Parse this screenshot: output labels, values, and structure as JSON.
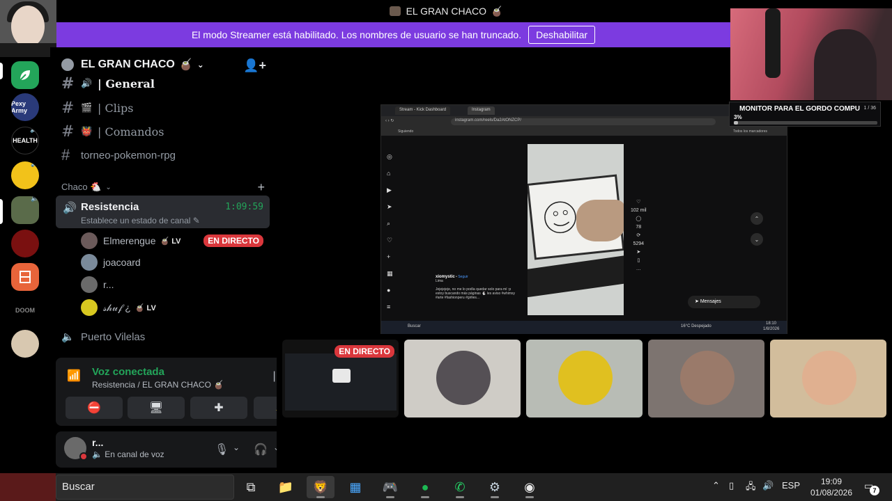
{
  "window": {
    "title": "EL GRAN CHACO",
    "title_emoji": "🧉"
  },
  "banner": {
    "text": "El modo Streamer está habilitado. Los nombres de usuario se han truncado.",
    "button": "Deshabilitar"
  },
  "servers": [
    {
      "label": "",
      "color": "#23a55a",
      "active": true
    },
    {
      "label": "Pexy Army",
      "color": "#2a3a7a"
    },
    {
      "label": "HEALTH",
      "color": "#000000",
      "speaker": true
    },
    {
      "label": "",
      "color": "#f2c21a",
      "speaker": true
    },
    {
      "label": "",
      "color": "#5a6b4a",
      "speaker": true,
      "active": true
    },
    {
      "label": "",
      "color": "#7a1010"
    },
    {
      "label": "",
      "color": "#e8643a"
    },
    {
      "label": "DOOM",
      "color": "#000000"
    },
    {
      "label": "",
      "color": "#d8c8b0"
    }
  ],
  "sidebar": {
    "server_name": "EL GRAN CHACO",
    "server_emoji": "🧉",
    "channels": [
      {
        "icon": "🔊",
        "name": "| General"
      },
      {
        "icon": "🎬",
        "name": "| Clips"
      },
      {
        "icon": "👹",
        "name": "| Comandos"
      },
      {
        "icon": "",
        "name": "torneo-pokemon-rpg"
      }
    ],
    "category": "Chaco 🐔",
    "voice_channel": {
      "name": "Resistencia",
      "time": "1:09:59",
      "status": "Establece un estado de canal"
    },
    "voice_users": [
      {
        "name": "Elmerengue",
        "badge": "🧉 LV",
        "live": "EN DIRECTO",
        "color": "#6b5a5a"
      },
      {
        "name": "joacoard",
        "badge": "",
        "live": "",
        "color": "#7a8a9a"
      },
      {
        "name": "r...",
        "badge": "",
        "live": "",
        "color": "#6a6a6a"
      },
      {
        "name": "𝓈𝒽𝓊𝒻 ¿",
        "badge": "🧉 LV",
        "live": "",
        "color": "#d8c820"
      }
    ],
    "voice2": "Puerto Vilelas"
  },
  "voice_panel": {
    "title": "Voz conectada",
    "subtitle": "Resistencia / EL GRAN CHACO 🧉",
    "buttons": [
      "camera-off",
      "screen-share",
      "activities",
      "soundboard"
    ]
  },
  "user_panel": {
    "name": "r...",
    "status": "En canal de voz"
  },
  "stream": {
    "tabs": [
      "Stream - Kick Dashboard",
      "Instagram"
    ],
    "url": "instagram.com/reels/Da2AtONZCP/",
    "bookmark": "Siguiendo",
    "all_bookmarks": "Todos los marcadores",
    "author": "xiomystic",
    "follow": "Seguir",
    "location": "Lima",
    "caption": "Jejejejeje, no me lo podía quedar solo para mí :p estoy buscando más páginas 🐇 les aviso #whimsy #arte #fashionperu #girlies...",
    "likes": "102 mil",
    "comments": "78",
    "reposts": "5294",
    "messages": "Mensajes",
    "taskbar_search": "Buscar",
    "weather": "16°C Despejado",
    "time": "18:10",
    "date": "1/8/2026"
  },
  "overlay": {
    "goal_title": "MONITOR PARA EL GORDO COMPU",
    "goal_count": "1 / 36",
    "goal_pct": "3%",
    "goal_value": 0.03
  },
  "tiles": {
    "live_tag": "EN DIRECTO",
    "participants": [
      {
        "bg": "#cfccc6",
        "face": "#555055"
      },
      {
        "bg": "#b8bcb5",
        "face": "#e0c020"
      },
      {
        "bg": "#7d7470",
        "face": "#9a7a6a"
      },
      {
        "bg": "#d2bd9c",
        "face": "#e0b090"
      }
    ]
  },
  "taskbar": {
    "search": "Buscar",
    "apps": [
      "task-view",
      "file-explorer",
      "brave",
      "store",
      "discord",
      "spotify",
      "whatsapp",
      "steam",
      "obs"
    ],
    "lang": "ESP",
    "time": "19:09",
    "date": "01/08/2026",
    "notifications": "7"
  }
}
